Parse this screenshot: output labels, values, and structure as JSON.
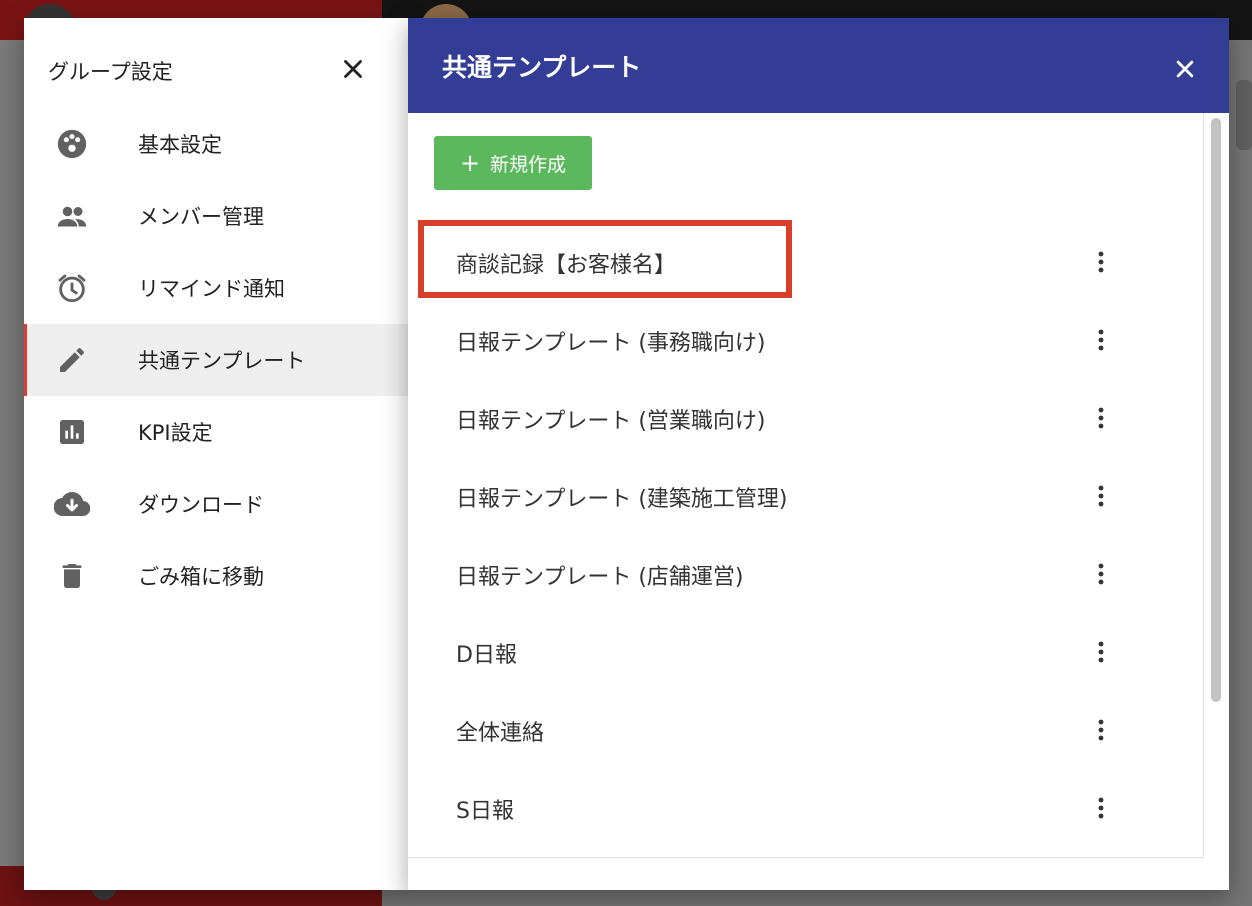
{
  "left_panel": {
    "title": "グループ設定",
    "menu": [
      {
        "label": "基本設定",
        "icon": "palette-icon",
        "active": false
      },
      {
        "label": "メンバー管理",
        "icon": "people-icon",
        "active": false
      },
      {
        "label": "リマインド通知",
        "icon": "alarm-icon",
        "active": false
      },
      {
        "label": "共通テンプレート",
        "icon": "pencil-icon",
        "active": true
      },
      {
        "label": "KPI設定",
        "icon": "bar-chart-icon",
        "active": false
      },
      {
        "label": "ダウンロード",
        "icon": "cloud-download-icon",
        "active": false
      },
      {
        "label": "ごみ箱に移動",
        "icon": "trash-icon",
        "active": false
      }
    ]
  },
  "right_panel": {
    "title": "共通テンプレート",
    "new_button_label": "新規作成",
    "templates": [
      {
        "label": "商談記録【お客様名】",
        "highlighted": true
      },
      {
        "label": "日報テンプレート (事務職向け)",
        "highlighted": false
      },
      {
        "label": "日報テンプレート (営業職向け)",
        "highlighted": false
      },
      {
        "label": "日報テンプレート (建築施工管理)",
        "highlighted": false
      },
      {
        "label": "日報テンプレート (店舗運営)",
        "highlighted": false
      },
      {
        "label": "D日報",
        "highlighted": false
      },
      {
        "label": "全体連絡",
        "highlighted": false
      },
      {
        "label": "S日報",
        "highlighted": false
      }
    ]
  },
  "colors": {
    "header_bg": "#343d96",
    "new_button_bg": "#5cb85c",
    "active_indicator": "#e53935",
    "highlight_border": "#d6402a",
    "icon_gray": "#616161"
  }
}
